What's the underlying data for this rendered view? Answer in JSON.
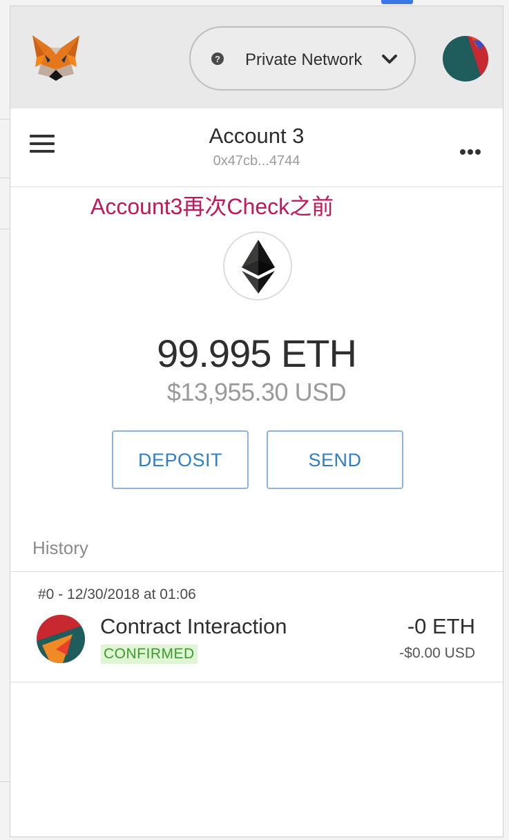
{
  "header": {
    "network_label": "Private Network",
    "network_help_glyph": "?",
    "icons": {
      "logo": "metamask-fox-icon",
      "help": "question-circle-icon",
      "dropdown": "chevron-down-icon",
      "account": "identicon-avatar"
    }
  },
  "account": {
    "name": "Account 3",
    "address": "0x47cb...4744"
  },
  "annotation": "Account3再次Check之前",
  "balance": {
    "eth": "99.995 ETH",
    "usd": "$13,955.30 USD"
  },
  "actions": {
    "deposit_label": "DEPOSIT",
    "send_label": "SEND"
  },
  "history": {
    "title": "History",
    "transactions": [
      {
        "meta": "#0 - 12/30/2018 at 01:06",
        "title": "Contract Interaction",
        "status": "CONFIRMED",
        "amount": "-0 ETH",
        "fiat": "-$0.00 USD"
      }
    ]
  },
  "colors": {
    "accent_blue": "#2f7fc8",
    "confirmed_green": "#3d9a2f",
    "annotation_pink": "#c2185b",
    "header_gray": "#e9e9e9"
  }
}
